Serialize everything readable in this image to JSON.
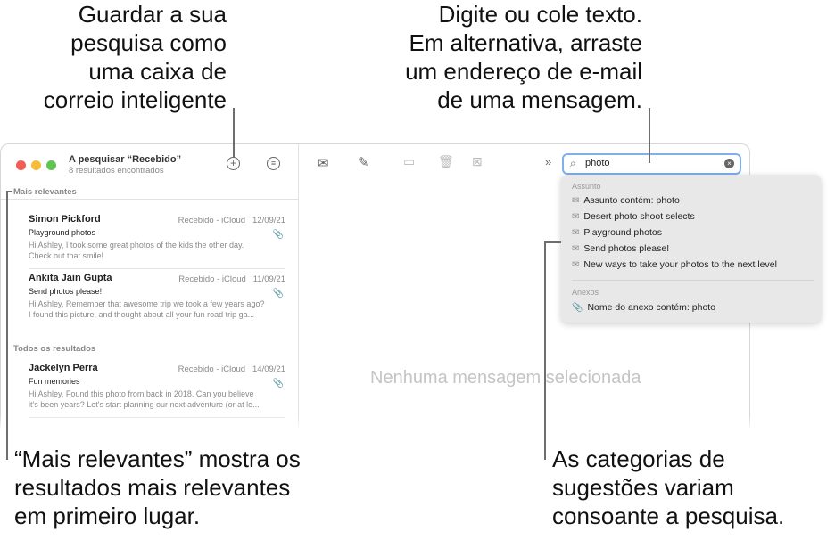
{
  "callouts": {
    "save_search": [
      "Guardar a sua",
      "pesquisa como",
      "uma caixa de",
      "correio inteligente"
    ],
    "type_text": [
      "Digite ou cole texto.",
      "Em alternativa, arraste",
      "um endereço de e-mail",
      "de uma mensagem."
    ],
    "top_hits": [
      "“Mais relevantes” mostra os",
      "resultados mais relevantes",
      "em primeiro lugar."
    ],
    "categories": [
      "As categorias de",
      "sugestões variam",
      "consoante a pesquisa."
    ]
  },
  "window": {
    "traffic_colors": [
      "#ee5f57",
      "#f5bd3a",
      "#5fc454"
    ],
    "title": "A pesquisar “Recebido”",
    "subtitle": "8 resultados encontrados",
    "sections": {
      "top": "Mais relevantes",
      "all": "Todos os resultados"
    },
    "messages": [
      {
        "from": "Simon Pickford",
        "mailbox": "Recebido - iCloud",
        "date": "12/09/21",
        "subject": "Playground photos",
        "preview": [
          "Hi Ashley, I took some great photos of the kids the other day.",
          "Check out that smile!"
        ]
      },
      {
        "from": "Ankita Jain Gupta",
        "mailbox": "Recebido - iCloud",
        "date": "11/09/21",
        "subject": "Send photos please!",
        "preview": [
          "Hi Ashley, Remember that awesome trip we took a few years ago?",
          "I found this picture, and thought about all your fun road trip ga..."
        ]
      },
      {
        "from": "Jackelyn Perra",
        "mailbox": "Recebido - iCloud",
        "date": "14/09/21",
        "subject": "Fun memories",
        "preview": [
          "Hi Ashley, Found this photo from back in 2018. Can you believe",
          "it's been years? Let's start planning our next adventure (or at le..."
        ]
      }
    ],
    "search_value": "photo",
    "empty_message": "Nenhuma mensagem selecionada",
    "dropdown": {
      "subject_header": "Assunto",
      "subject_items": [
        "Assunto contém: photo",
        "Desert photo shoot selects",
        "Playground photos",
        "Send photos please!",
        "New ways to take your photos to the next level"
      ],
      "attach_header": "Anexos",
      "attach_items": [
        "Nome do anexo contém: photo"
      ]
    }
  }
}
